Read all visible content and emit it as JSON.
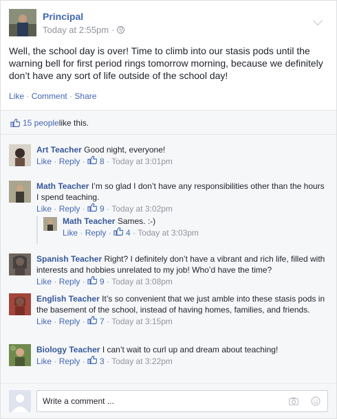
{
  "post": {
    "author": "Principal",
    "timestamp": "Today at 2:55pm",
    "text": "Well, the school day is over! Time to climb into our stasis pods until the warning bell for first period rings tomorrow morning, because we definitely don’t have any sort of life outside of the school day!",
    "actions": {
      "like": "Like",
      "comment": "Comment",
      "share": "Share"
    }
  },
  "likes": {
    "count_text": "15 people",
    "suffix": " like this."
  },
  "comment_actions": {
    "like": "Like",
    "reply": "Reply"
  },
  "comments": [
    {
      "author": "Art Teacher",
      "text": "Good night, everyone!",
      "likes": "8",
      "time": "Today at 3:01pm"
    },
    {
      "author": "Math Teacher",
      "text": "I’m so glad I don’t have any responsibilities other than the hours I spend teaching.",
      "likes": "9",
      "time": "Today at 3:02pm"
    },
    {
      "author": "Math Teacher",
      "text": "Sames. :-)",
      "likes": "4",
      "time": "Today at 3:03pm"
    },
    {
      "author": "Spanish Teacher",
      "text": "Right? I definitely don’t have a vibrant and rich life, filled with interests and hobbies unrelated to my job! Who’d have the time?",
      "likes": "9",
      "time": "Today at 3:08pm"
    },
    {
      "author": "English Teacher",
      "text": "It’s so convenient that we just amble into these stasis pods in the basement of the school, instead of having homes, families, and friends.",
      "likes": "7",
      "time": "Today at 3:15pm"
    },
    {
      "author": "Biology Teacher",
      "text": "I can’t wait to curl up and dream about teaching!",
      "likes": "3",
      "time": "Today at 3:22pm"
    }
  ],
  "composer": {
    "placeholder": "Write a comment ..."
  },
  "colors": {
    "link": "#4267b2",
    "name": "#365899",
    "meta": "#90949c",
    "bg": "#f6f7f9"
  },
  "icons": [
    "chevron-down-icon",
    "globe-icon",
    "thumbs-up-icon",
    "camera-icon",
    "smiley-icon"
  ]
}
